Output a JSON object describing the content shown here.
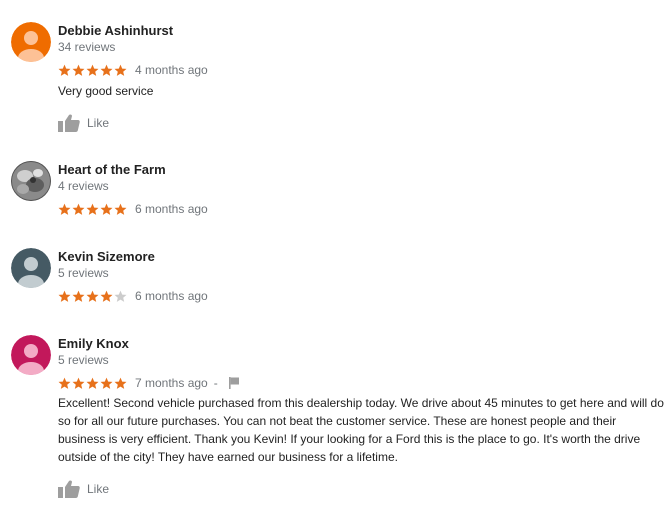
{
  "reviews": [
    {
      "name": "Debbie Ashinhurst",
      "count": "34 reviews",
      "rating": 5,
      "time": "4 months ago",
      "text": "Very good service",
      "like_label": "Like",
      "avatar_color": "#ef6c00",
      "avatar_icon": "person-icon"
    },
    {
      "name": "Heart of the Farm",
      "count": "4 reviews",
      "rating": 5,
      "time": "6 months ago",
      "avatar_icon": "photo-avatar"
    },
    {
      "name": "Kevin Sizemore",
      "count": "5 reviews",
      "rating": 4,
      "time": "6 months ago",
      "avatar_color": "#455a64",
      "avatar_icon": "person-icon"
    },
    {
      "name": "Emily Knox",
      "count": "5 reviews",
      "rating": 5,
      "time": "7 months ago",
      "separator": "-",
      "text": "Excellent! Second vehicle purchased from this dealership today. We drive about 45 minutes to get here and will do so for all our future purchases. You can not beat the customer service. These are honest people and their business is very efficient. Thank you Kevin! If your looking for a Ford this is the place to go. It's worth the drive outside of the city! They have earned our business for a lifetime.",
      "like_label": "Like",
      "avatar_color": "#c2185b",
      "avatar_icon": "person-icon"
    }
  ],
  "colors": {
    "star_filled": "#e7711b",
    "star_empty": "#cccccc",
    "muted_text": "#70757a",
    "icon_gray": "#9e9e9e"
  }
}
